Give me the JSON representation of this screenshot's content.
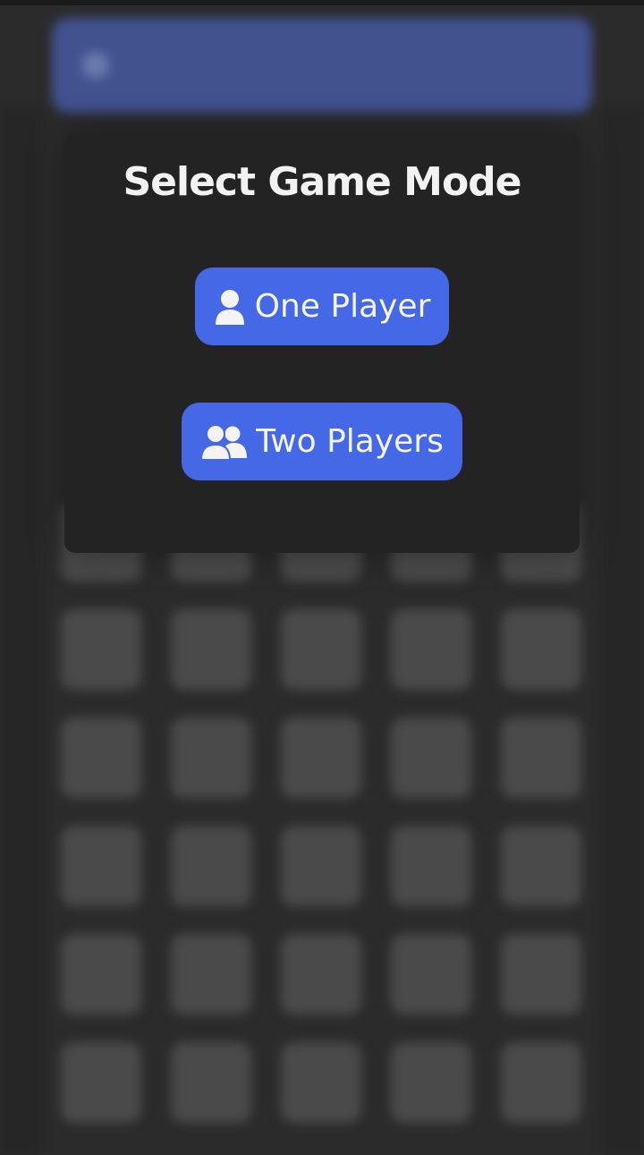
{
  "modal": {
    "title": "Select Game Mode",
    "buttons": [
      {
        "label": "One Player",
        "icon": "user-icon"
      },
      {
        "label": "Two Players",
        "icon": "users-icon"
      }
    ]
  },
  "colors": {
    "accent": "#4568e6",
    "modal_bg": "#232323",
    "page_bg": "#2b2b2b",
    "board_cell": "#4a4a4a",
    "header_bg": "#41528f"
  },
  "board": {
    "rows": 6,
    "columns": 5
  }
}
